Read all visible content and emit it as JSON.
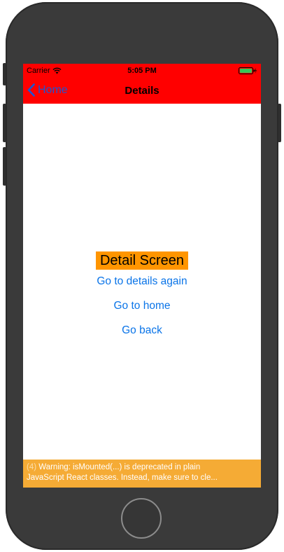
{
  "status_bar": {
    "carrier": "Carrier",
    "time": "5:05 PM",
    "battery_color": "#34c759"
  },
  "nav_bar": {
    "back_label": "Home",
    "title": "Details",
    "background": "#ff0000"
  },
  "content": {
    "title": "Detail Screen",
    "buttons": [
      {
        "label": "Go to details again"
      },
      {
        "label": "Go to home"
      },
      {
        "label": "Go back"
      }
    ]
  },
  "warning": {
    "count": "(4)",
    "line1": "Warning: isMounted(...) is deprecated in plain",
    "line2": "JavaScript React classes. Instead, make sure to cle..."
  },
  "icons": [
    "wifi-icon",
    "battery-icon",
    "chevron-left-icon",
    "home-button"
  ]
}
